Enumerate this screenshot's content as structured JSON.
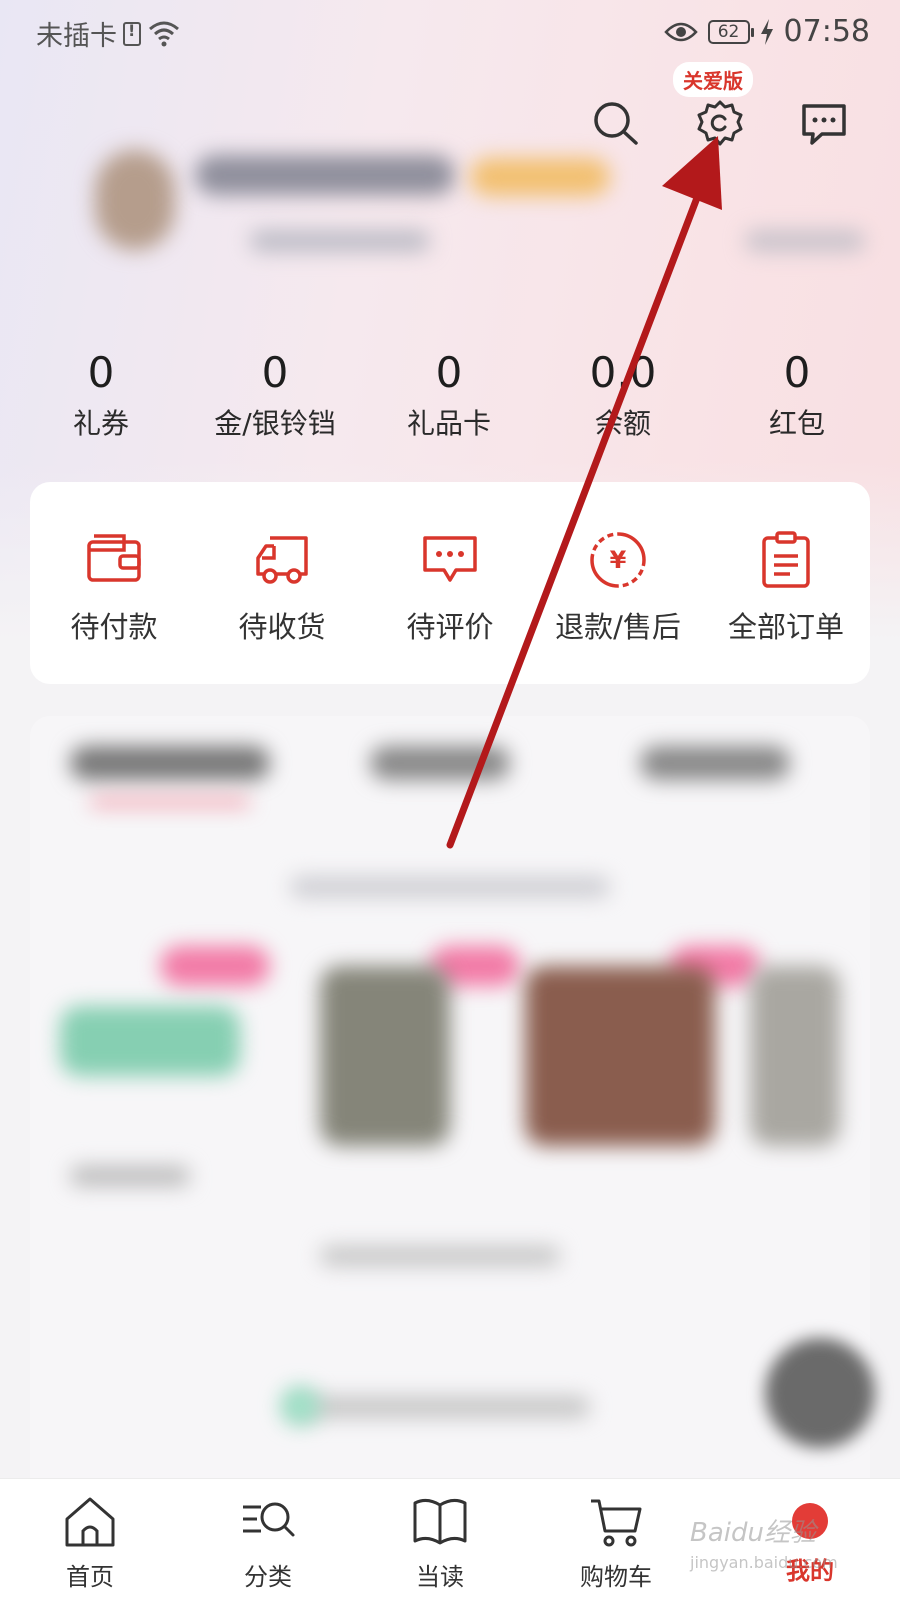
{
  "status_bar": {
    "carrier": "未插卡",
    "battery": "62",
    "time": "07:58"
  },
  "header": {
    "care_mode_label": "关爱版",
    "icons": [
      "search-icon",
      "gear-icon",
      "message-icon"
    ]
  },
  "stats": [
    {
      "value": "0",
      "label": "礼券"
    },
    {
      "value": "0",
      "label": "金/银铃铛"
    },
    {
      "value": "0",
      "label": "礼品卡"
    },
    {
      "value": "0.0",
      "label": "余额"
    },
    {
      "value": "0",
      "label": "红包"
    }
  ],
  "orders": [
    {
      "label": "待付款",
      "icon": "wallet-icon"
    },
    {
      "label": "待收货",
      "icon": "truck-icon"
    },
    {
      "label": "待评价",
      "icon": "comment-icon"
    },
    {
      "label": "退款/售后",
      "icon": "refund-icon"
    },
    {
      "label": "全部订单",
      "icon": "clipboard-icon"
    }
  ],
  "bottom_nav": [
    {
      "label": "首页",
      "icon": "home-icon"
    },
    {
      "label": "分类",
      "icon": "category-icon"
    },
    {
      "label": "当读",
      "icon": "book-icon"
    },
    {
      "label": "购物车",
      "icon": "cart-icon"
    },
    {
      "label": "我的",
      "icon": "profile-icon",
      "active": true
    }
  ],
  "watermark": {
    "brand": "Baidu经验",
    "url": "jingyan.baidu.com"
  },
  "colors": {
    "accent": "#d9362c",
    "annotation_arrow": "#b3191b"
  }
}
